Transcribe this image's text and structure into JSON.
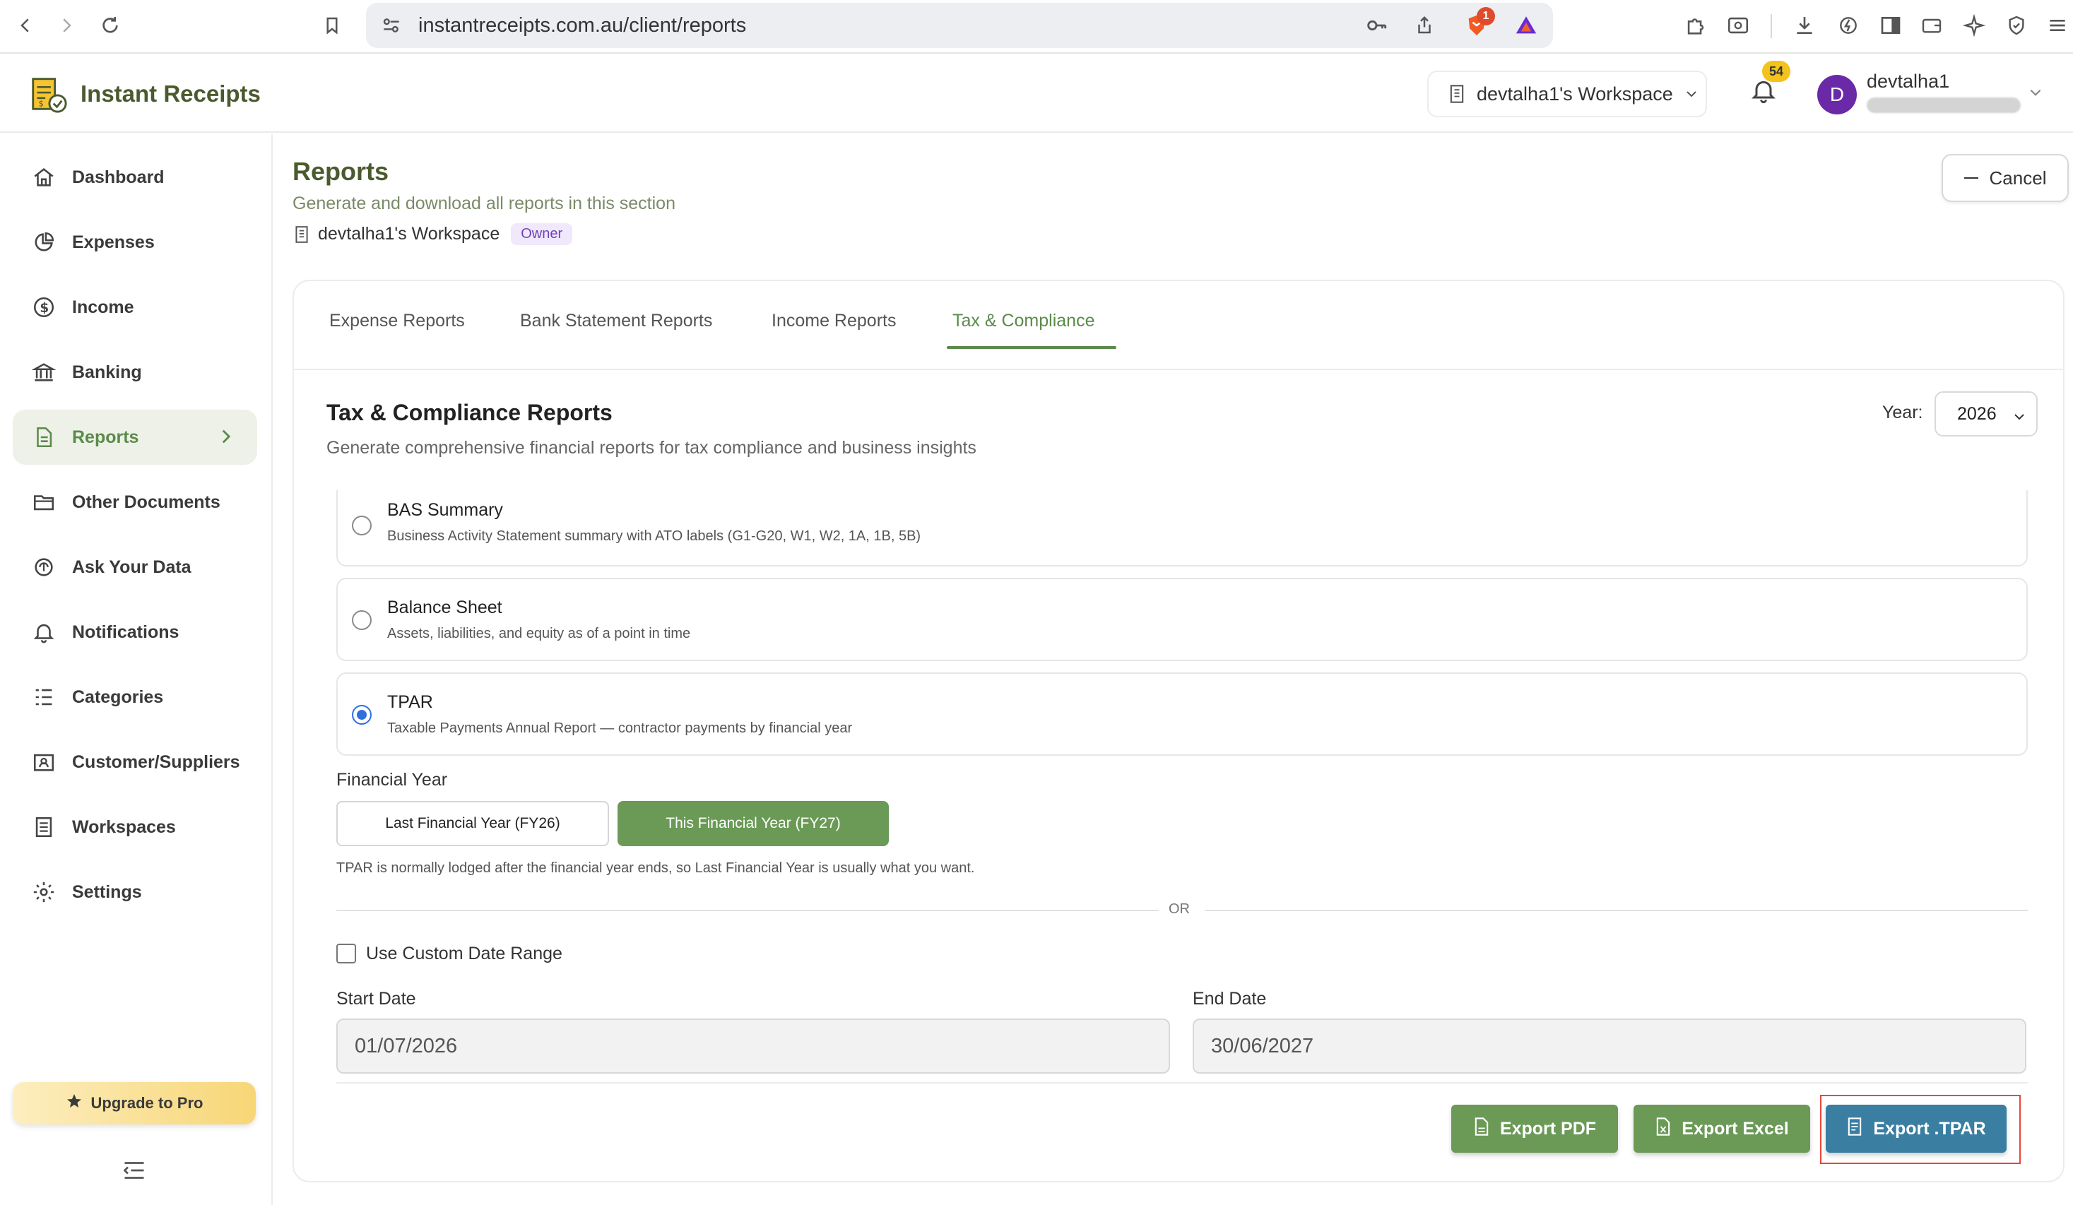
{
  "browser": {
    "url": "instantreceipts.com.au/client/reports",
    "shield_count": "1"
  },
  "header": {
    "brand": "Instant Receipts",
    "workspace": "devtalha1's Workspace",
    "notification_count": "54",
    "avatar_letter": "D",
    "user_name": "devtalha1"
  },
  "sidebar": {
    "items": [
      {
        "label": "Dashboard",
        "icon": "home-icon"
      },
      {
        "label": "Expenses",
        "icon": "pie-chart-icon"
      },
      {
        "label": "Income",
        "icon": "dollar-circle-icon"
      },
      {
        "label": "Banking",
        "icon": "bank-icon"
      },
      {
        "label": "Reports",
        "icon": "document-icon"
      },
      {
        "label": "Other Documents",
        "icon": "folder-icon"
      },
      {
        "label": "Ask Your Data",
        "icon": "ai-icon"
      },
      {
        "label": "Notifications",
        "icon": "bell-icon"
      },
      {
        "label": "Categories",
        "icon": "list-icon"
      },
      {
        "label": "Customer/Suppliers",
        "icon": "contacts-icon"
      },
      {
        "label": "Workspaces",
        "icon": "building-icon"
      },
      {
        "label": "Settings",
        "icon": "gear-icon"
      }
    ],
    "active": "Reports",
    "upgrade_label": "Upgrade to Pro"
  },
  "page": {
    "title": "Reports",
    "subtitle": "Generate and download all reports in this section",
    "workspace": "devtalha1's Workspace",
    "role_badge": "Owner",
    "cancel_label": "Cancel"
  },
  "tabs": [
    "Expense Reports",
    "Bank Statement Reports",
    "Income Reports",
    "Tax & Compliance"
  ],
  "active_tab": "Tax & Compliance",
  "section": {
    "title": "Tax & Compliance Reports",
    "subtitle": "Generate comprehensive financial reports for tax compliance and business insights",
    "year_label": "Year:",
    "year_value": "2026"
  },
  "reports": [
    {
      "name": "BAS Summary",
      "desc": "Business Activity Statement summary with ATO labels (G1-G20, W1, W2, 1A, 1B, 5B)",
      "selected": false
    },
    {
      "name": "Balance Sheet",
      "desc": "Assets, liabilities, and equity as of a point in time",
      "selected": false
    },
    {
      "name": "TPAR",
      "desc": "Taxable Payments Annual Report — contractor payments by financial year",
      "selected": true
    }
  ],
  "financial_year": {
    "label": "Financial Year",
    "last_fy": "Last Financial Year (FY26)",
    "this_fy": "This Financial Year (FY27)",
    "note": "TPAR is normally lodged after the financial year ends, so Last Financial Year is usually what you want."
  },
  "or_text": "OR",
  "custom_range": {
    "label": "Use Custom Date Range",
    "checked": false,
    "start_label": "Start Date",
    "start_value": "01/07/2026",
    "end_label": "End Date",
    "end_value": "30/06/2027"
  },
  "exports": {
    "pdf": "Export PDF",
    "excel": "Export Excel",
    "tpar": "Export .TPAR"
  },
  "colors": {
    "brand_green": "#5b8a4a",
    "button_green": "#6a9a56",
    "button_blue": "#3a7ea2",
    "highlight_red": "#e8463a"
  }
}
